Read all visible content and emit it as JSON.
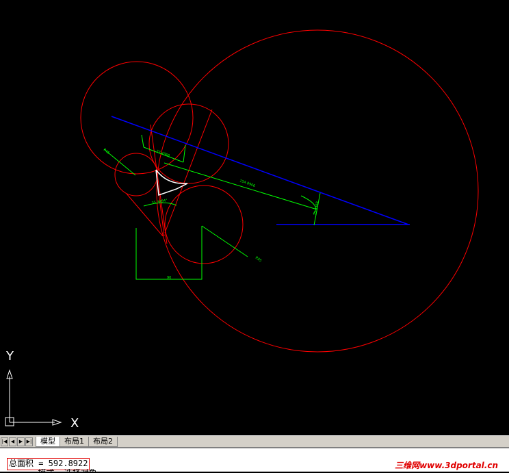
{
  "viewport": {
    "background": "#000000",
    "ucs": {
      "y_label": "Y",
      "x_label": "X"
    },
    "dimensions": {
      "top_small": "33.4368",
      "diag_long": "154.8906",
      "angle_left": "35.3494°",
      "vertical_right": "33.4368",
      "radius_a": "R45",
      "radius_b": "R85",
      "bottom_width": "90"
    },
    "colors": {
      "circles": "#ff0000",
      "lines": "#0000ff",
      "dims": "#00ff00",
      "region": "#ffffff"
    }
  },
  "tabs": {
    "nav": [
      "|◀",
      "◀",
      "▶",
      "▶|"
    ],
    "items": [
      {
        "label": "模型",
        "active": true
      },
      {
        "label": "布局1",
        "active": false
      },
      {
        "label": "布局2",
        "active": false
      }
    ]
  },
  "command": {
    "result": "总面积 = 592.8922",
    "line2": "      模式  选择对象"
  },
  "watermark": "三维网www.3dportal.cn"
}
